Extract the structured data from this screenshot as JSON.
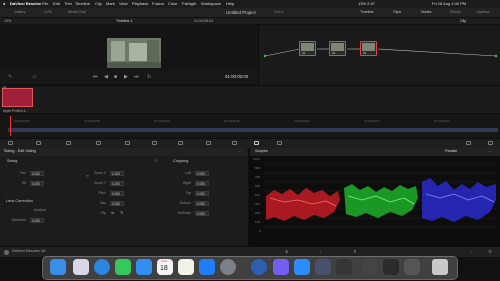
{
  "menubar": {
    "app": "DaVinci Resolve",
    "items": [
      "File",
      "Edit",
      "Trim",
      "Timeline",
      "Clip",
      "Mark",
      "View",
      "Playback",
      "Fusion",
      "Color",
      "Fairlight",
      "Workspace",
      "Help"
    ],
    "status": "13% 2:47",
    "datetime": "Fri 18 Aug 4:40 PM"
  },
  "toolbar": {
    "zoom": "19%",
    "left_items": [
      "Gallery",
      "LUTs",
      "Media Pool"
    ],
    "project": "Untitled Project",
    "edited": "Edited",
    "right_items": [
      "Timeline",
      "Clips",
      "Nodes",
      "Effects",
      "Lightbox"
    ]
  },
  "viewer": {
    "zoom": "19%",
    "timeline_name": "Timeline 1",
    "timecode_top": "01:00:06:04",
    "timecode": "01:00:00:00",
    "node_mode": "Clip"
  },
  "nodes": [
    {
      "label": "01"
    },
    {
      "label": "02"
    },
    {
      "label": "03"
    }
  ],
  "clips": {
    "index": "01",
    "duration": "00:00:00:00",
    "name": "Apple ProRes 4..."
  },
  "timeline": {
    "ticks": [
      "01:00:00:00",
      "01:00:02:05",
      "01:00:04:10",
      "01:00:06:16",
      "01:00:08:21",
      "01:00:10:27",
      "01:00:13:02"
    ]
  },
  "sizing": {
    "header": "Sizing - Edit Sizing",
    "section_sizing": "Sizing",
    "pan_label": "Pan",
    "pan": "0.000",
    "tilt_label": "Tilt",
    "tilt": "0.000",
    "zoomx_label": "Zoom X",
    "zoomx": "1.000",
    "zoomy_label": "Zoom Y",
    "zoomy": "1.000",
    "pitch_label": "Pitch",
    "pitch": "0.000",
    "yaw_label": "Yaw",
    "yaw": "0.000",
    "flip_label": "Flip",
    "lens_section": "Lens Correction",
    "analyze": "Analyze",
    "distortion_label": "Distortion",
    "distortion": "0.000",
    "section_cropping": "Cropping",
    "left_label": "Left",
    "left": "0.000",
    "right_label": "Right",
    "right": "0.000",
    "top_label": "Top",
    "top": "0.000",
    "bottom_label": "Bottom",
    "bottom": "0.000",
    "softness_label": "Softness",
    "softness": "0.000"
  },
  "scopes": {
    "header": "Scopes",
    "mode": "Parade",
    "scale": [
      "1023",
      "896",
      "768",
      "640",
      "512",
      "384",
      "256",
      "128",
      "0"
    ],
    "colors": {
      "red": "#d0202a",
      "green": "#20c030",
      "blue": "#3030d0"
    }
  },
  "statusbar": {
    "app": "DaVinci Resolve 18"
  },
  "dock": {
    "calendar_month": "AUG",
    "calendar_day": "18",
    "icons": [
      "finder-icon",
      "launchpad-icon",
      "safari-icon",
      "messages-icon",
      "mail-icon",
      "maps-icon",
      "photos-icon",
      "facetime-icon",
      "calendar-icon",
      "notes-icon",
      "app-store-icon",
      "settings-icon",
      "resolve-icon",
      "viber-icon",
      "zoom-icon",
      "screenshot-icon",
      "davinci-icon",
      "folder-icon",
      "terminal-icon",
      "preview-icon",
      "trash-icon"
    ]
  }
}
